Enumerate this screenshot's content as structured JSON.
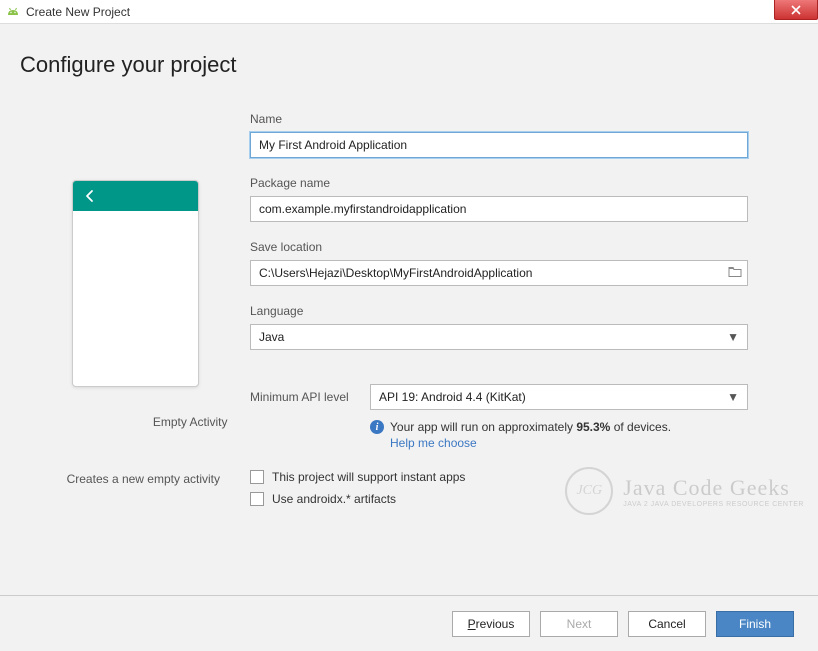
{
  "window": {
    "title": "Create New Project"
  },
  "page": {
    "heading": "Configure your project"
  },
  "form": {
    "name": {
      "label": "Name",
      "value": "My First Android Application"
    },
    "package": {
      "label": "Package name",
      "value": "com.example.myfirstandroidapplication"
    },
    "save": {
      "label": "Save location",
      "value": "C:\\Users\\Hejazi\\Desktop\\MyFirstAndroidApplication"
    },
    "language": {
      "label": "Language",
      "value": "Java"
    },
    "api": {
      "label": "Minimum API level",
      "value": "API 19: Android 4.4 (KitKat)"
    },
    "info_prefix": "Your app will run on approximately ",
    "info_pct": "95.3%",
    "info_suffix": " of devices.",
    "help": "Help me choose",
    "chk_instant": "This project will support instant apps",
    "chk_androidx": "Use androidx.* artifacts"
  },
  "preview": {
    "label": "Empty Activity",
    "desc": "Creates a new empty activity"
  },
  "footer": {
    "previous": "Previous",
    "next": "Next",
    "cancel": "Cancel",
    "finish": "Finish"
  },
  "watermark": {
    "line1": "Java Code Geeks",
    "line2": "JAVA 2 JAVA DEVELOPERS RESOURCE CENTER",
    "badge": "JCG"
  }
}
